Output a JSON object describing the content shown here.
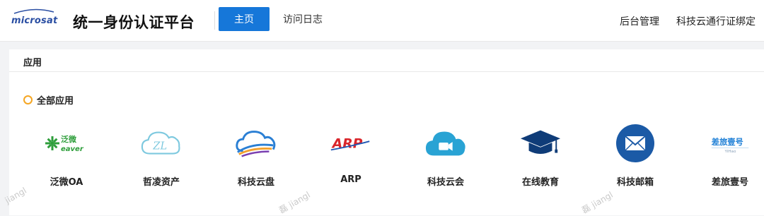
{
  "header": {
    "logo_text": "microsat",
    "title": "统一身份认证平台",
    "nav": {
      "home": "主页",
      "logs": "访问日志"
    },
    "right": {
      "admin": "后台管理",
      "bind": "科技云通行证绑定"
    }
  },
  "panel": {
    "tab_label": "应用",
    "section_title": "全部应用",
    "apps": [
      {
        "label": "泛微OA",
        "icon": "weaver-oa-icon",
        "icon_text_1": "泛微",
        "icon_text_2": "eaver"
      },
      {
        "label": "哲凌资产",
        "icon": "cloud-zl-icon",
        "icon_text": "ZL"
      },
      {
        "label": "科技云盘",
        "icon": "cloud-disk-icon"
      },
      {
        "label": "ARP",
        "icon": "arp-icon",
        "icon_text": "ARP"
      },
      {
        "label": "科技云会",
        "icon": "cloud-meeting-icon"
      },
      {
        "label": "在线教育",
        "icon": "graduation-cap-icon"
      },
      {
        "label": "科技邮箱",
        "icon": "mail-icon"
      },
      {
        "label": "差旅壹号",
        "icon": "travel-icon",
        "icon_text_1": "差旅壹号",
        "icon_text_2": "YiHao"
      }
    ]
  },
  "watermarks": [
    "jiangl",
    "磊 jiangl",
    "磊 jiangl"
  ],
  "colors": {
    "primary": "#1677d9",
    "accent": "#f5a623",
    "logo": "#2b4fa3"
  }
}
